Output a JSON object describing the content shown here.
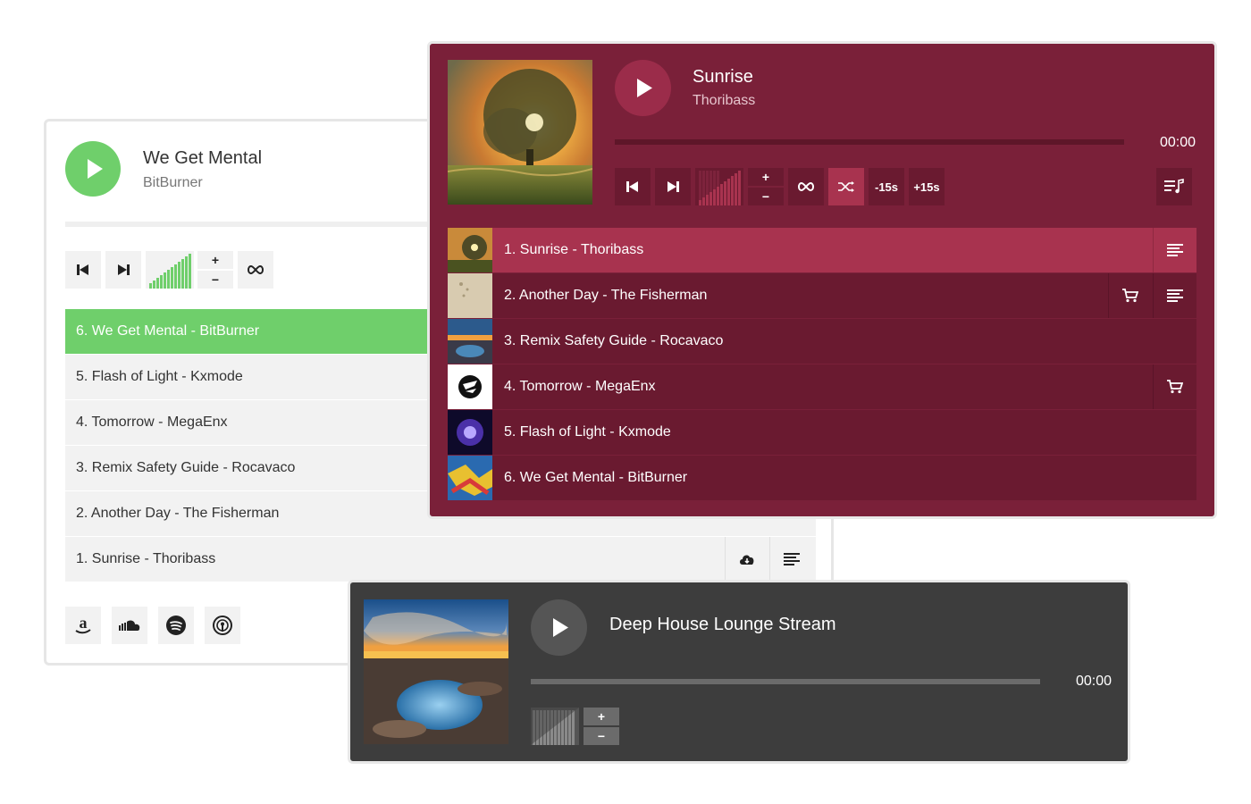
{
  "white_player": {
    "now_playing": {
      "title": "We Get Mental",
      "artist": "BitBurner"
    },
    "controls": {
      "volume_up": "+",
      "volume_down": "−"
    },
    "playlist": [
      {
        "label": "6. We Get Mental - BitBurner",
        "active": true
      },
      {
        "label": "5. Flash of Light - Kxmode",
        "active": false
      },
      {
        "label": "4. Tomorrow - MegaEnx",
        "active": false
      },
      {
        "label": "3. Remix Safety Guide - Rocavaco",
        "active": false
      },
      {
        "label": "2. Another Day - The Fisherman",
        "active": false
      },
      {
        "label": "1. Sunrise - Thoribass",
        "active": false,
        "buttons": [
          "cloud-download-icon",
          "lyrics-icon"
        ]
      }
    ],
    "stores": [
      "amazon-icon",
      "soundcloud-icon",
      "spotify-icon",
      "podcast-icon"
    ],
    "accent": "#6fcf6b"
  },
  "maroon_player": {
    "now_playing": {
      "title": "Sunrise",
      "artist": "Thoribass"
    },
    "time": "00:00",
    "controls": {
      "volume_up": "+",
      "volume_down": "−",
      "skip_back": "-15s",
      "skip_forward": "+15s"
    },
    "playlist": [
      {
        "label": "1. Sunrise - Thoribass",
        "active": true,
        "buttons": [
          "lyrics-icon"
        ]
      },
      {
        "label": "2. Another Day - The Fisherman",
        "active": false,
        "buttons": [
          "cart-icon",
          "lyrics-icon"
        ]
      },
      {
        "label": "3. Remix Safety Guide - Rocavaco",
        "active": false
      },
      {
        "label": "4. Tomorrow - MegaEnx",
        "active": false,
        "buttons": [
          "cart-icon"
        ]
      },
      {
        "label": "5. Flash of Light - Kxmode",
        "active": false
      },
      {
        "label": "6. We Get Mental - BitBurner",
        "active": false
      }
    ],
    "accent": "#7a2039"
  },
  "dark_player": {
    "now_playing": {
      "title": "Deep House Lounge Stream"
    },
    "time": "00:00",
    "controls": {
      "volume_up": "+",
      "volume_down": "−"
    },
    "accent": "#3d3d3d"
  }
}
